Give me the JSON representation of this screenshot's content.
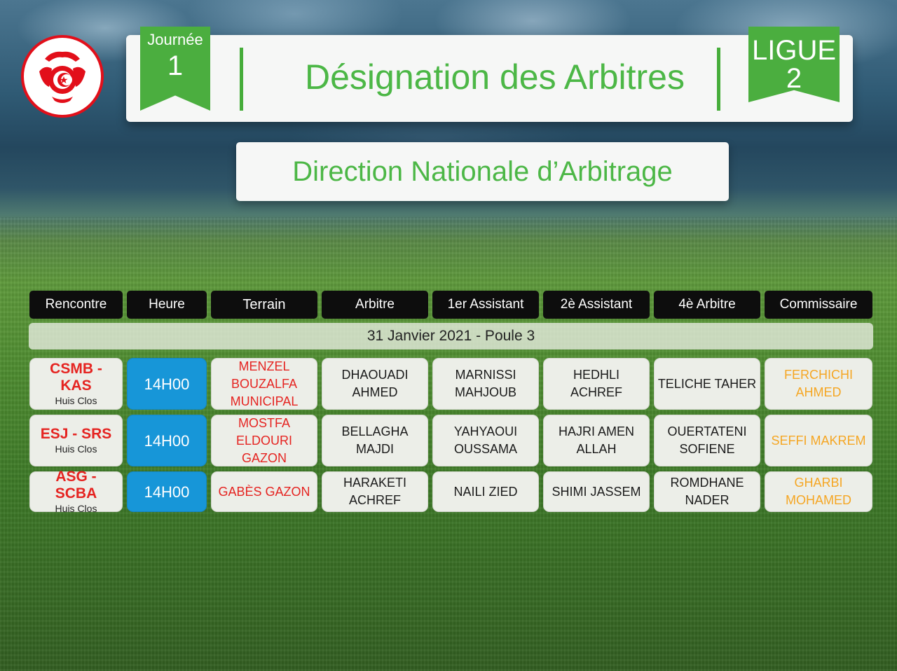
{
  "journee": {
    "label": "Journée",
    "number": "1"
  },
  "title": "Désignation des Arbitres",
  "subtitle": "Direction Nationale d’Arbitrage",
  "ligue": {
    "label": "LIGUE",
    "number": "2"
  },
  "colors": {
    "green": "#4cb746",
    "red": "#e52421",
    "blue": "#1796d8",
    "orange": "#f5a623"
  },
  "headers": [
    "Rencontre",
    "Heure",
    "Terrain",
    "Arbitre",
    "1er Assistant",
    "2è Assistant",
    "4è Arbitre",
    "Commissaire"
  ],
  "date_line": "31 Janvier 2021 - Poule 3",
  "rows": [
    {
      "match": "CSMB - KAS",
      "status": "Huis Clos",
      "time": "14H00",
      "terrain": "MENZEL BOUZALFA MUNICIPAL",
      "arbitre": "DHAOUADI AHMED",
      "assistant1": "MARNISSI MAHJOUB",
      "assistant2": "HEDHLI ACHREF",
      "arbitre4": "TELICHE TAHER",
      "commissaire": "FERCHICHI AHMED"
    },
    {
      "match": "ESJ - SRS",
      "status": "Huis Clos",
      "time": "14H00",
      "terrain": "MOSTFA ELDOURI GAZON",
      "arbitre": "BELLAGHA MAJDI",
      "assistant1": "YAHYAOUI OUSSAMA",
      "assistant2": "HAJRI AMEN ALLAH",
      "arbitre4": "OUERTATENI SOFIENE",
      "commissaire": "SEFFI MAKREM"
    },
    {
      "match": "ASG - SCBA",
      "status": "Huis Clos",
      "time": "14H00",
      "terrain": "GABÈS GAZON",
      "arbitre": "HARAKETI ACHREF",
      "assistant1": "NAILI ZIED",
      "assistant2": "SHIMI JASSEM",
      "arbitre4": "ROMDHANE NADER",
      "commissaire": "GHARBI MOHAMED"
    }
  ]
}
